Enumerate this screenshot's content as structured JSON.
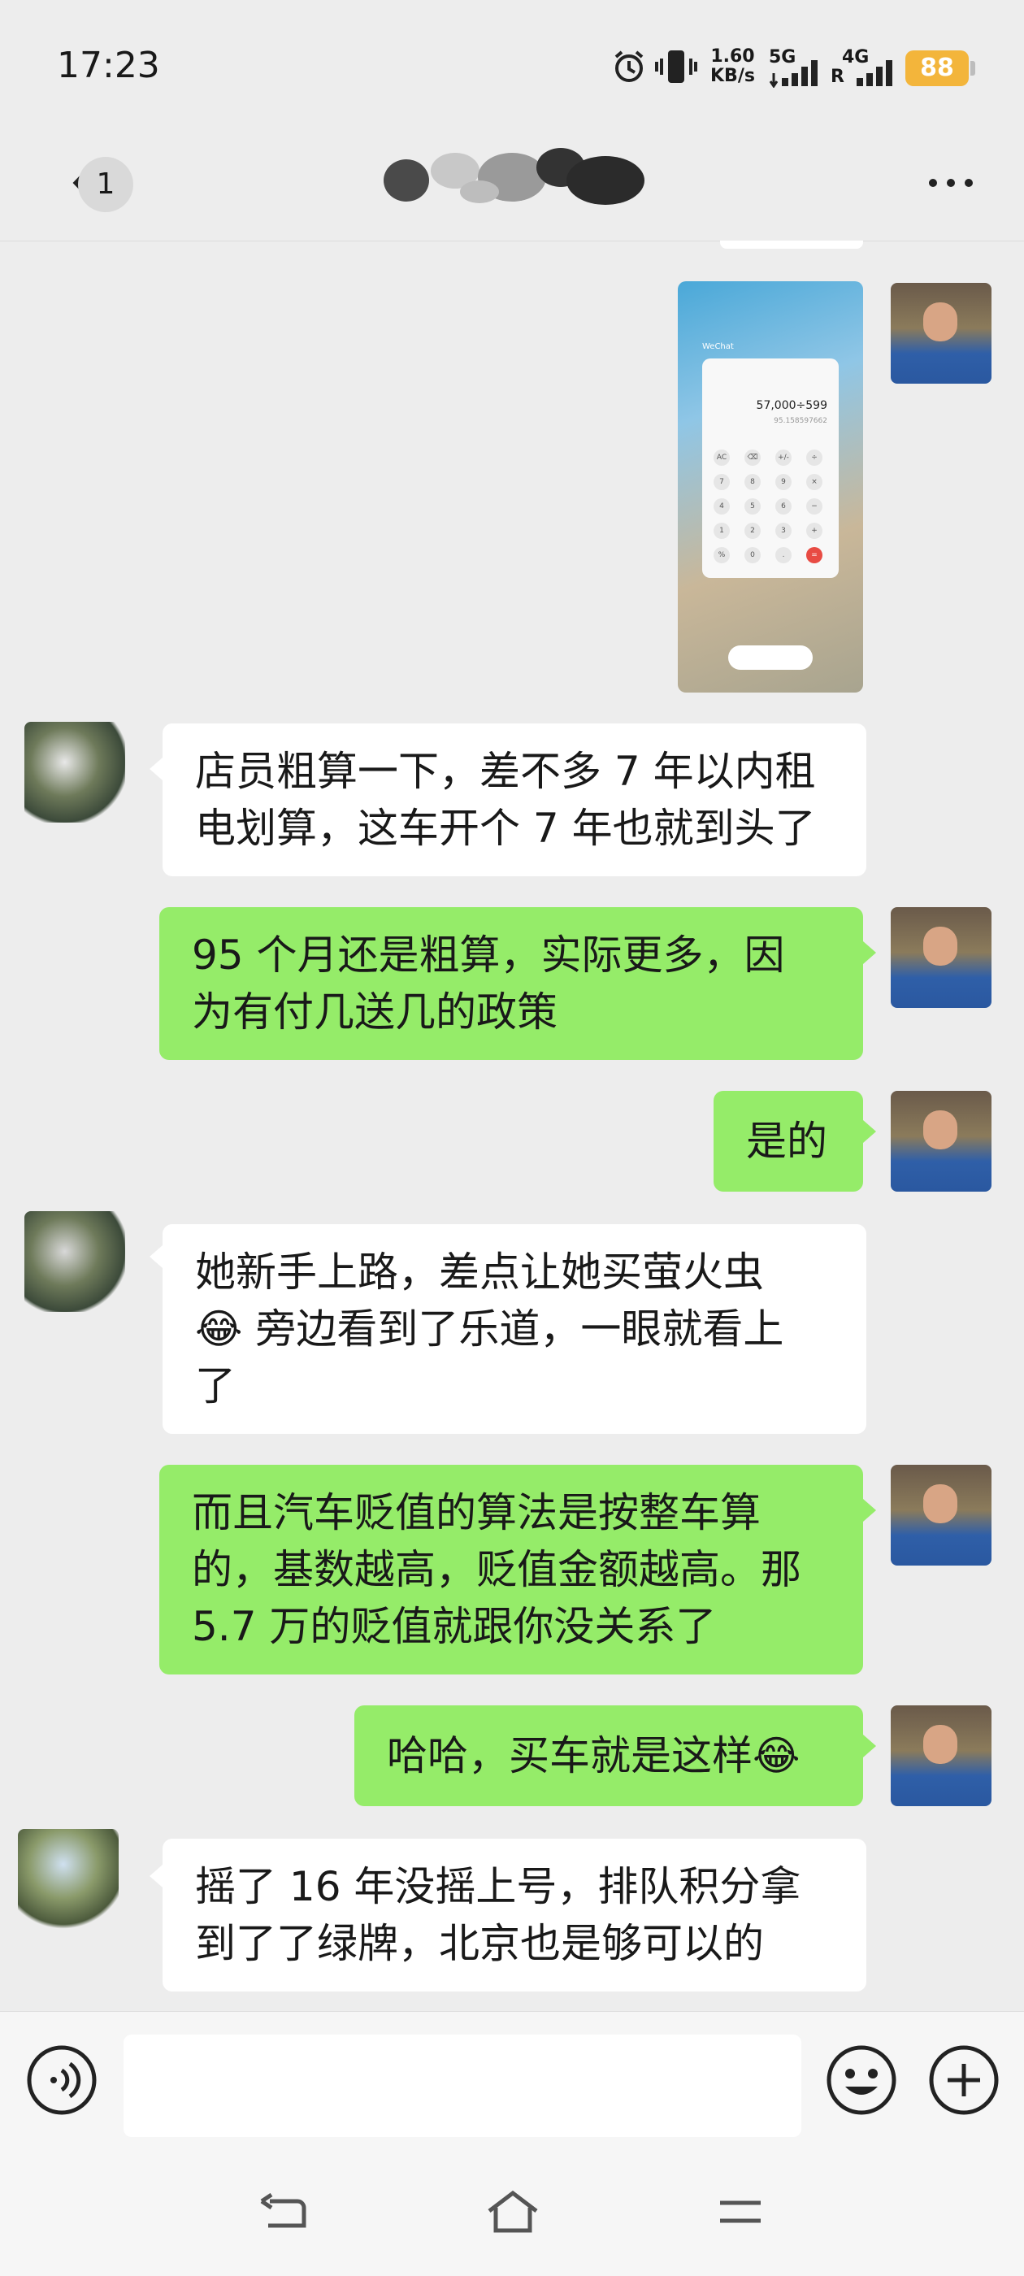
{
  "status_bar": {
    "time": "17:23",
    "net_speed_value": "1.60",
    "net_speed_unit": "KB/s",
    "sim1_label": "5G",
    "sim2_label": "4G",
    "sim2_sub": "R",
    "battery": "88",
    "icons": [
      "alarm-icon",
      "vibrate-icon",
      "signal-icon",
      "signal-icon"
    ]
  },
  "title_bar": {
    "unread_count": "1",
    "icons": [
      "back-icon",
      "more-icon"
    ]
  },
  "messages": [
    {
      "side": "out",
      "type": "image"
    },
    {
      "side": "in",
      "text": "店员粗算一下，差不多 7 年以内租\n电划算，这车开个 7 年也就到头了"
    },
    {
      "side": "out",
      "text": "95 个月还是粗算，实际更多，因\n为有付几送几的政策"
    },
    {
      "side": "out",
      "text": "是的"
    },
    {
      "side": "in",
      "text": "她新手上路，差点让她买萤火虫\n😂 旁边看到了乐道，一眼就看上\n了"
    },
    {
      "side": "out",
      "text": "而且汽车贬值的算法是按整车算\n的，基数越高，贬值金额越高。那\n5.7 万的贬值就跟你没关系了"
    },
    {
      "side": "out",
      "text": "哈哈，买车就是这样😂"
    },
    {
      "side": "in",
      "text": "摇了 16 年没摇上号，排队积分拿\n到了了绿牌，北京也是够可以的"
    }
  ],
  "image_message": {
    "app_label": "WeChat",
    "calc_display": "57,000÷599",
    "calc_result": "95.158597662",
    "keys": [
      "AC",
      "⌫",
      "+/-",
      "÷",
      "7",
      "8",
      "9",
      "×",
      "4",
      "5",
      "6",
      "−",
      "1",
      "2",
      "3",
      "+",
      "%",
      "0",
      ".",
      "="
    ]
  },
  "input_bar": {
    "input_value": "",
    "icons": [
      "voice-icon",
      "emoji-icon",
      "plus-icon"
    ]
  },
  "nav_bar": {
    "icons": [
      "back-nav-icon",
      "home-nav-icon",
      "menu-nav-icon"
    ]
  },
  "colors": {
    "background": "#ededed",
    "outgoing_bubble": "#95ec69",
    "incoming_bubble": "#ffffff",
    "battery": "#f3b53b"
  }
}
